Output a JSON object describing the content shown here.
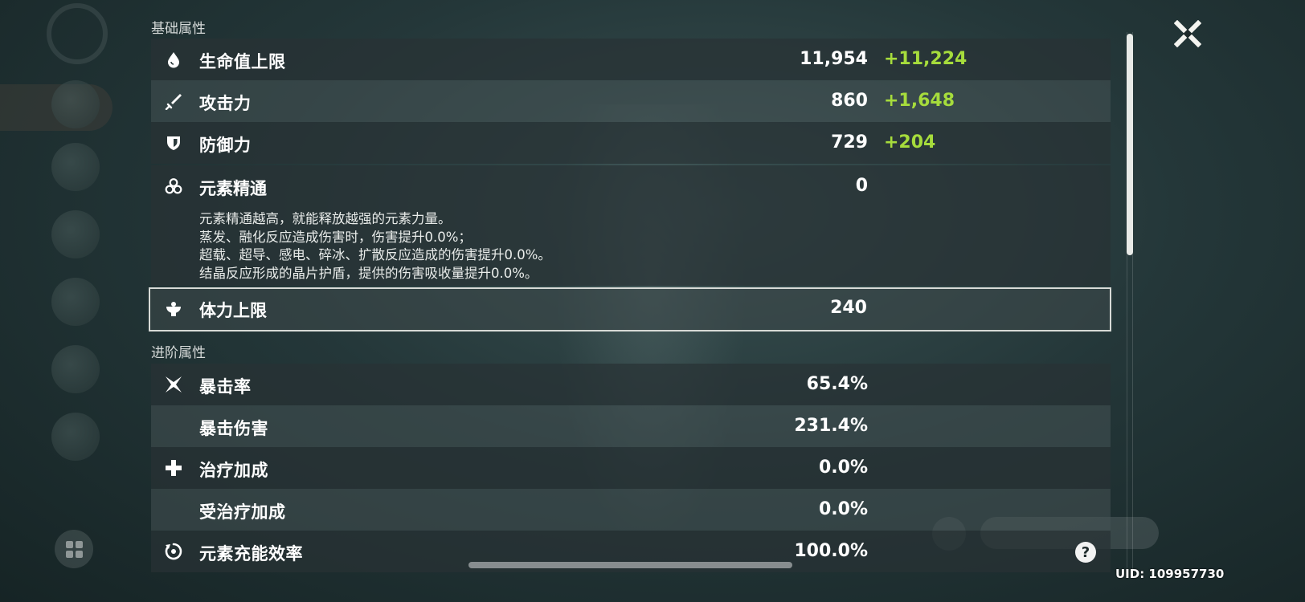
{
  "sections": {
    "base": "基础属性",
    "advanced": "进阶属性"
  },
  "stats": {
    "hp": {
      "name": "生命值上限",
      "value": "11,954",
      "bonus": "+11,224",
      "icon": "hp-drop-icon"
    },
    "atk": {
      "name": "攻击力",
      "value": "860",
      "bonus": "+1,648",
      "icon": "sword-icon"
    },
    "def": {
      "name": "防御力",
      "value": "729",
      "bonus": "+204",
      "icon": "shield-icon"
    },
    "em": {
      "name": "元素精通",
      "value": "0",
      "icon": "elemental-mastery-icon",
      "description": [
        "元素精通越高，就能释放越强的元素力量。",
        "蒸发、融化反应造成伤害时，伤害提升0.0%；",
        "超载、超导、感电、碎冰、扩散反应造成的伤害提升0.0%。",
        "结晶反应形成的晶片护盾，提供的伤害吸收量提升0.0%。"
      ]
    },
    "stamina": {
      "name": "体力上限",
      "value": "240",
      "icon": "stamina-icon"
    },
    "crit_rate": {
      "name": "暴击率",
      "value": "65.4%",
      "icon": "crit-icon"
    },
    "crit_dmg": {
      "name": "暴击伤害",
      "value": "231.4%"
    },
    "heal": {
      "name": "治疗加成",
      "value": "0.0%",
      "icon": "healing-cross-icon"
    },
    "incoming_heal": {
      "name": "受治疗加成",
      "value": "0.0%"
    },
    "er": {
      "name": "元素充能效率",
      "value": "100.0%",
      "icon": "energy-recharge-icon"
    }
  },
  "uid": "UID: 109957730",
  "help_label": "?",
  "colors": {
    "bonus": "#a6dc3c",
    "accent": "#d7dad6"
  }
}
